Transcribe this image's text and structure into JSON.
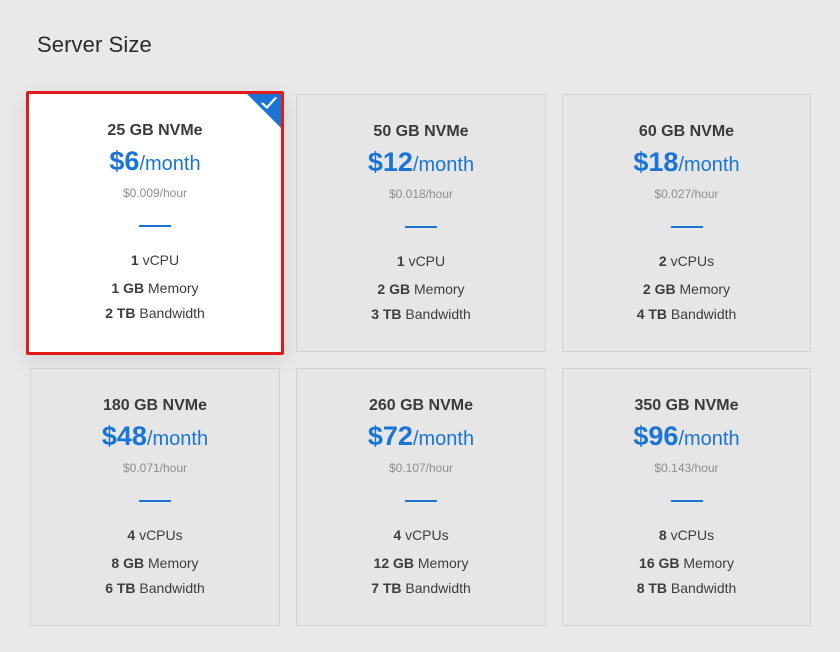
{
  "section": {
    "title": "Server Size"
  },
  "accent_color": "#1a74d6",
  "selected_outline_color": "#e11a1a",
  "plans": [
    {
      "storage": "25 GB NVMe",
      "price": "$6",
      "per": "/month",
      "hourly": "$0.009/hour",
      "cpu_value": "1",
      "cpu_unit": "vCPU",
      "mem_value": "1 GB",
      "mem_unit": "Memory",
      "bw_value": "2 TB",
      "bw_unit": "Bandwidth",
      "selected": true
    },
    {
      "storage": "50 GB NVMe",
      "price": "$12",
      "per": "/month",
      "hourly": "$0.018/hour",
      "cpu_value": "1",
      "cpu_unit": "vCPU",
      "mem_value": "2 GB",
      "mem_unit": "Memory",
      "bw_value": "3 TB",
      "bw_unit": "Bandwidth",
      "selected": false
    },
    {
      "storage": "60 GB NVMe",
      "price": "$18",
      "per": "/month",
      "hourly": "$0.027/hour",
      "cpu_value": "2",
      "cpu_unit": "vCPUs",
      "mem_value": "2 GB",
      "mem_unit": "Memory",
      "bw_value": "4 TB",
      "bw_unit": "Bandwidth",
      "selected": false
    },
    {
      "storage": "180 GB NVMe",
      "price": "$48",
      "per": "/month",
      "hourly": "$0.071/hour",
      "cpu_value": "4",
      "cpu_unit": "vCPUs",
      "mem_value": "8 GB",
      "mem_unit": "Memory",
      "bw_value": "6 TB",
      "bw_unit": "Bandwidth",
      "selected": false
    },
    {
      "storage": "260 GB NVMe",
      "price": "$72",
      "per": "/month",
      "hourly": "$0.107/hour",
      "cpu_value": "4",
      "cpu_unit": "vCPUs",
      "mem_value": "12 GB",
      "mem_unit": "Memory",
      "bw_value": "7 TB",
      "bw_unit": "Bandwidth",
      "selected": false
    },
    {
      "storage": "350 GB NVMe",
      "price": "$96",
      "per": "/month",
      "hourly": "$0.143/hour",
      "cpu_value": "8",
      "cpu_unit": "vCPUs",
      "mem_value": "16 GB",
      "mem_unit": "Memory",
      "bw_value": "8 TB",
      "bw_unit": "Bandwidth",
      "selected": false
    }
  ],
  "icons": {
    "selected_marker": "checkmark-icon"
  }
}
